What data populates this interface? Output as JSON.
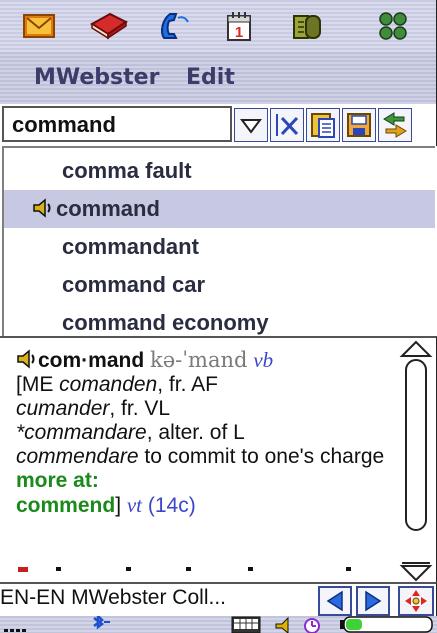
{
  "appbar": {
    "icons": [
      "mail-icon",
      "book-icon",
      "phone-icon",
      "calendar-icon",
      "contacts-icon",
      "apps-grid-icon"
    ],
    "calendar_day": "1"
  },
  "menu": {
    "items": [
      "MWebster",
      "Edit"
    ]
  },
  "search": {
    "value": "command"
  },
  "toolbar": {
    "buttons": [
      "dropdown-arrow-icon",
      "clear-field-icon",
      "paste-icon",
      "save-icon",
      "switch-direction-icon"
    ]
  },
  "suggestions": {
    "items": [
      "comma fault",
      "command",
      "commandant",
      "command car",
      "command economy"
    ],
    "selected_index": 1
  },
  "definition": {
    "headword": "com·mand",
    "pronunciation": "kə-ˈmand",
    "pos": "vb",
    "etym_1": "[ME ",
    "etym_2": "comanden",
    "etym_3": ", fr. AF",
    "etym_4": "cumander",
    "etym_5": ", fr. VL",
    "etym_6": "*commandare",
    "etym_7": ", alter. of L",
    "etym_8": "commendare",
    "etym_9": " to commit to one's charge ",
    "more_at": "more at:",
    "xref": "commend",
    "etym_close": "] ",
    "pos2": "vt",
    "date": "(14c)"
  },
  "statusbar": {
    "dictionary_name": "EN-EN MWebster Coll..."
  },
  "colors": {
    "accent": "#3b46c8",
    "xref_green": "#1a8a1a",
    "selection": "#c7c9e3",
    "menu_text": "#3a3c6a"
  }
}
